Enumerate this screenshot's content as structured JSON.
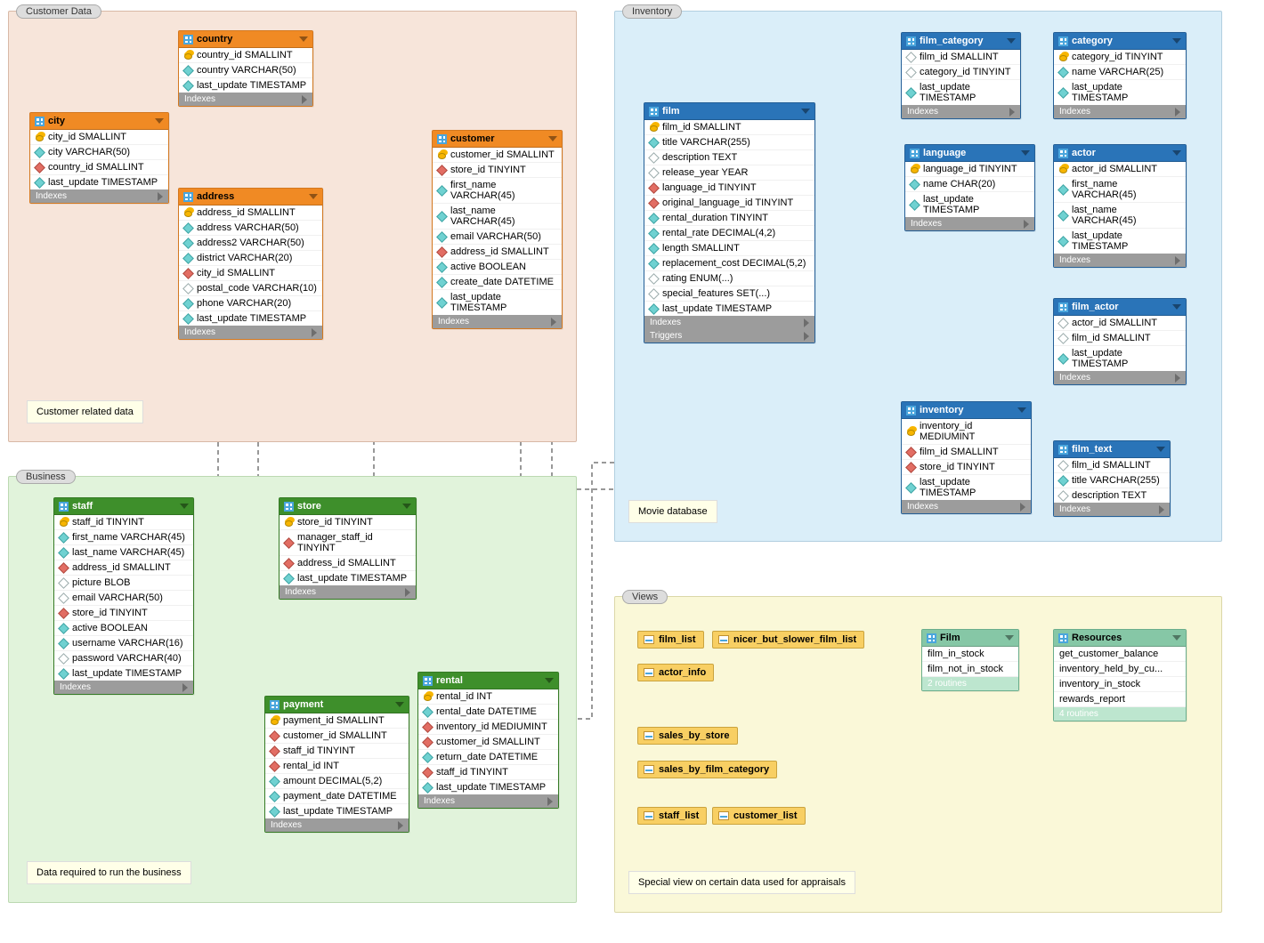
{
  "regions": {
    "customer": {
      "title": "Customer Data",
      "note": "Customer related data"
    },
    "business": {
      "title": "Business",
      "note": "Data required to run the business"
    },
    "inventory": {
      "title": "Inventory",
      "note": "Movie database"
    },
    "views": {
      "title": "Views",
      "note": "Special view on certain data used for appraisals"
    }
  },
  "collapsed_labels": {
    "indexes": "Indexes",
    "triggers": "Triggers"
  },
  "tables": {
    "country": {
      "title": "country",
      "columns": [
        {
          "k": "key",
          "t": "country_id SMALLINT"
        },
        {
          "k": "idx",
          "t": "country VARCHAR(50)"
        },
        {
          "k": "idx",
          "t": "last_update TIMESTAMP"
        }
      ]
    },
    "city": {
      "title": "city",
      "columns": [
        {
          "k": "key",
          "t": "city_id SMALLINT"
        },
        {
          "k": "idx",
          "t": "city VARCHAR(50)"
        },
        {
          "k": "fk",
          "t": "country_id SMALLINT"
        },
        {
          "k": "idx",
          "t": "last_update TIMESTAMP"
        }
      ]
    },
    "address": {
      "title": "address",
      "columns": [
        {
          "k": "key",
          "t": "address_id SMALLINT"
        },
        {
          "k": "idx",
          "t": "address VARCHAR(50)"
        },
        {
          "k": "idx",
          "t": "address2 VARCHAR(50)"
        },
        {
          "k": "idx",
          "t": "district VARCHAR(20)"
        },
        {
          "k": "fk",
          "t": "city_id SMALLINT"
        },
        {
          "k": "plain",
          "t": "postal_code VARCHAR(10)"
        },
        {
          "k": "idx",
          "t": "phone VARCHAR(20)"
        },
        {
          "k": "idx",
          "t": "last_update TIMESTAMP"
        }
      ]
    },
    "customer": {
      "title": "customer",
      "columns": [
        {
          "k": "key",
          "t": "customer_id SMALLINT"
        },
        {
          "k": "fk",
          "t": "store_id TINYINT"
        },
        {
          "k": "idx",
          "t": "first_name VARCHAR(45)"
        },
        {
          "k": "idx",
          "t": "last_name VARCHAR(45)"
        },
        {
          "k": "idx",
          "t": "email VARCHAR(50)"
        },
        {
          "k": "fk",
          "t": "address_id SMALLINT"
        },
        {
          "k": "idx",
          "t": "active BOOLEAN"
        },
        {
          "k": "idx",
          "t": "create_date DATETIME"
        },
        {
          "k": "idx",
          "t": "last_update TIMESTAMP"
        }
      ]
    },
    "staff": {
      "title": "staff",
      "columns": [
        {
          "k": "key",
          "t": "staff_id TINYINT"
        },
        {
          "k": "idx",
          "t": "first_name VARCHAR(45)"
        },
        {
          "k": "idx",
          "t": "last_name VARCHAR(45)"
        },
        {
          "k": "fk",
          "t": "address_id SMALLINT"
        },
        {
          "k": "plain",
          "t": "picture BLOB"
        },
        {
          "k": "plain",
          "t": "email VARCHAR(50)"
        },
        {
          "k": "fk",
          "t": "store_id TINYINT"
        },
        {
          "k": "idx",
          "t": "active BOOLEAN"
        },
        {
          "k": "idx",
          "t": "username VARCHAR(16)"
        },
        {
          "k": "plain",
          "t": "password VARCHAR(40)"
        },
        {
          "k": "idx",
          "t": "last_update TIMESTAMP"
        }
      ]
    },
    "store": {
      "title": "store",
      "columns": [
        {
          "k": "key",
          "t": "store_id TINYINT"
        },
        {
          "k": "fk",
          "t": "manager_staff_id TINYINT"
        },
        {
          "k": "fk",
          "t": "address_id SMALLINT"
        },
        {
          "k": "idx",
          "t": "last_update TIMESTAMP"
        }
      ]
    },
    "payment": {
      "title": "payment",
      "columns": [
        {
          "k": "key",
          "t": "payment_id SMALLINT"
        },
        {
          "k": "fk",
          "t": "customer_id SMALLINT"
        },
        {
          "k": "fk",
          "t": "staff_id TINYINT"
        },
        {
          "k": "fk",
          "t": "rental_id INT"
        },
        {
          "k": "idx",
          "t": "amount DECIMAL(5,2)"
        },
        {
          "k": "idx",
          "t": "payment_date DATETIME"
        },
        {
          "k": "idx",
          "t": "last_update TIMESTAMP"
        }
      ]
    },
    "rental": {
      "title": "rental",
      "columns": [
        {
          "k": "key",
          "t": "rental_id INT"
        },
        {
          "k": "idx",
          "t": "rental_date DATETIME"
        },
        {
          "k": "fk",
          "t": "inventory_id MEDIUMINT"
        },
        {
          "k": "fk",
          "t": "customer_id SMALLINT"
        },
        {
          "k": "idx",
          "t": "return_date DATETIME"
        },
        {
          "k": "fk",
          "t": "staff_id TINYINT"
        },
        {
          "k": "idx",
          "t": "last_update TIMESTAMP"
        }
      ]
    },
    "film": {
      "title": "film",
      "columns": [
        {
          "k": "key",
          "t": "film_id SMALLINT"
        },
        {
          "k": "idx",
          "t": "title VARCHAR(255)"
        },
        {
          "k": "plain",
          "t": "description TEXT"
        },
        {
          "k": "plain",
          "t": "release_year YEAR"
        },
        {
          "k": "fk",
          "t": "language_id TINYINT"
        },
        {
          "k": "fk",
          "t": "original_language_id TINYINT"
        },
        {
          "k": "idx",
          "t": "rental_duration TINYINT"
        },
        {
          "k": "idx",
          "t": "rental_rate DECIMAL(4,2)"
        },
        {
          "k": "idx",
          "t": "length SMALLINT"
        },
        {
          "k": "idx",
          "t": "replacement_cost DECIMAL(5,2)"
        },
        {
          "k": "plain",
          "t": "rating ENUM(...)"
        },
        {
          "k": "plain",
          "t": "special_features SET(...)"
        },
        {
          "k": "idx",
          "t": "last_update TIMESTAMP"
        }
      ]
    },
    "film_category": {
      "title": "film_category",
      "columns": [
        {
          "k": "plain",
          "t": "film_id SMALLINT"
        },
        {
          "k": "plain",
          "t": "category_id TINYINT"
        },
        {
          "k": "idx",
          "t": "last_update TIMESTAMP"
        }
      ]
    },
    "category": {
      "title": "category",
      "columns": [
        {
          "k": "key",
          "t": "category_id TINYINT"
        },
        {
          "k": "idx",
          "t": "name VARCHAR(25)"
        },
        {
          "k": "idx",
          "t": "last_update TIMESTAMP"
        }
      ]
    },
    "language": {
      "title": "language",
      "columns": [
        {
          "k": "key",
          "t": "language_id TINYINT"
        },
        {
          "k": "idx",
          "t": "name CHAR(20)"
        },
        {
          "k": "idx",
          "t": "last_update TIMESTAMP"
        }
      ]
    },
    "actor": {
      "title": "actor",
      "columns": [
        {
          "k": "key",
          "t": "actor_id SMALLINT"
        },
        {
          "k": "idx",
          "t": "first_name VARCHAR(45)"
        },
        {
          "k": "idx",
          "t": "last_name VARCHAR(45)"
        },
        {
          "k": "idx",
          "t": "last_update TIMESTAMP"
        }
      ]
    },
    "film_actor": {
      "title": "film_actor",
      "columns": [
        {
          "k": "plain",
          "t": "actor_id SMALLINT"
        },
        {
          "k": "plain",
          "t": "film_id SMALLINT"
        },
        {
          "k": "idx",
          "t": "last_update TIMESTAMP"
        }
      ]
    },
    "inventory": {
      "title": "inventory",
      "columns": [
        {
          "k": "key",
          "t": "inventory_id MEDIUMINT"
        },
        {
          "k": "fk",
          "t": "film_id SMALLINT"
        },
        {
          "k": "fk",
          "t": "store_id TINYINT"
        },
        {
          "k": "idx",
          "t": "last_update TIMESTAMP"
        }
      ]
    },
    "film_text": {
      "title": "film_text",
      "columns": [
        {
          "k": "plain",
          "t": "film_id SMALLINT"
        },
        {
          "k": "idx",
          "t": "title VARCHAR(255)"
        },
        {
          "k": "plain",
          "t": "description TEXT"
        }
      ]
    }
  },
  "views": {
    "chips": [
      "film_list",
      "nicer_but_slower_film_list",
      "actor_info",
      "sales_by_store",
      "sales_by_film_category",
      "staff_list",
      "customer_list"
    ],
    "film_group": {
      "title": "Film",
      "items": [
        "film_in_stock",
        "film_not_in_stock"
      ],
      "footer": "2 routines"
    },
    "res_group": {
      "title": "Resources",
      "items": [
        "get_customer_balance",
        "inventory_held_by_cu...",
        "inventory_in_stock",
        "rewards_report"
      ],
      "footer": "4 routines"
    }
  }
}
